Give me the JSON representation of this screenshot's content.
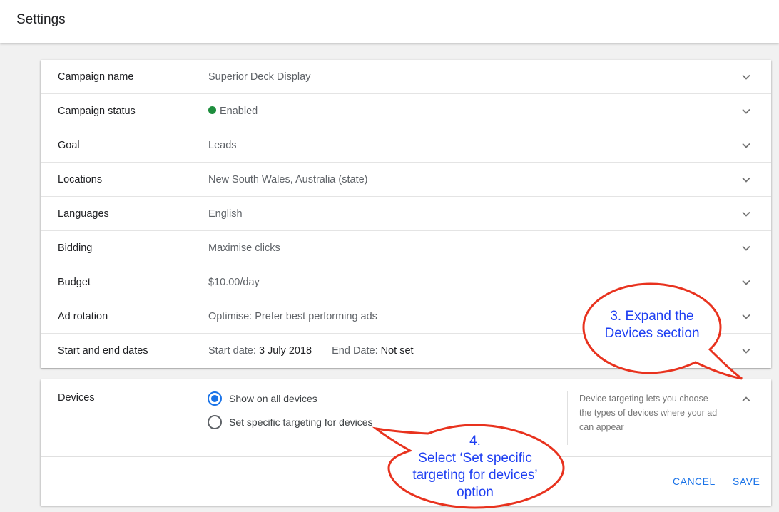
{
  "header": {
    "title": "Settings"
  },
  "settings_rows": [
    {
      "label": "Campaign name",
      "value": "Superior Deck Display"
    },
    {
      "label": "Campaign status",
      "value": "Enabled",
      "status_color": "#1e8e3e"
    },
    {
      "label": "Goal",
      "value": "Leads"
    },
    {
      "label": "Locations",
      "value": "New South Wales, Australia (state)"
    },
    {
      "label": "Languages",
      "value": "English"
    },
    {
      "label": "Bidding",
      "value": "Maximise clicks"
    },
    {
      "label": "Budget",
      "value": "$10.00/day"
    },
    {
      "label": "Ad rotation",
      "value": "Optimise: Prefer best performing ads"
    },
    {
      "label": "Start and end dates",
      "start_label": "Start date:",
      "start_value": "3 July 2018",
      "end_label": "End Date:",
      "end_value": "Not set"
    }
  ],
  "devices": {
    "label": "Devices",
    "options": [
      {
        "label": "Show on all devices",
        "selected": true
      },
      {
        "label": "Set specific targeting for devices",
        "selected": false
      }
    ],
    "help_text": "Device targeting lets you choose the types of devices where your ad can appear",
    "cancel_label": "CANCEL",
    "save_label": "SAVE"
  },
  "annotations": {
    "step3": {
      "line1": "3. Expand the",
      "line2": "Devices section"
    },
    "step4": {
      "line1": "4.",
      "line2": "Select ‘Set specific",
      "line3": "targeting for devices’",
      "line4": "option"
    }
  },
  "colors": {
    "accent": "#1a73e8",
    "callout_border": "#e8321e",
    "callout_text": "#1e3ff2"
  }
}
